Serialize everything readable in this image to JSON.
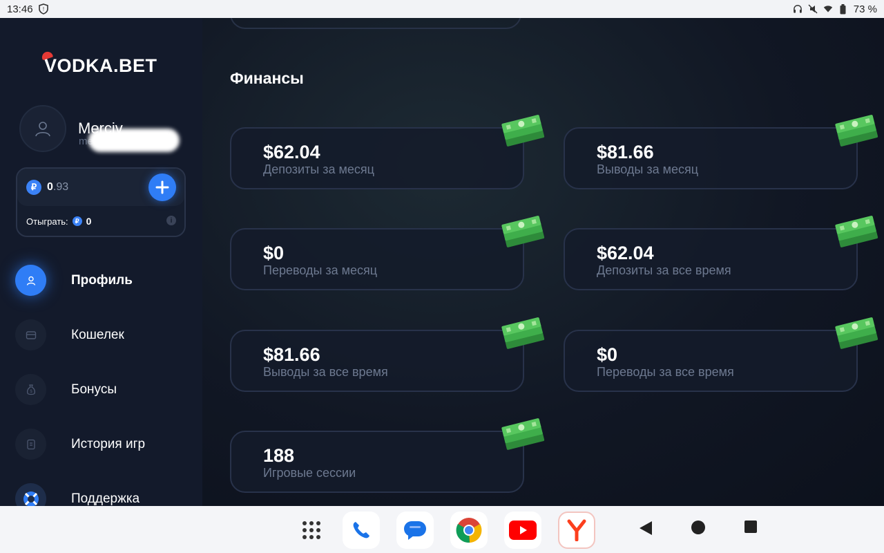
{
  "status_bar": {
    "time": "13:46",
    "battery_percent": "73 %"
  },
  "brand": {
    "logo_text": "VODKA",
    "logo_suffix": ".BET"
  },
  "profile": {
    "username": "Merciv",
    "username_sub": "me"
  },
  "wallet": {
    "currency_symbol": "₽",
    "balance_int": "0",
    "balance_frac": ".93",
    "wager_label": "Отыграть:",
    "wager_value": "0"
  },
  "nav": {
    "items": [
      {
        "label": "Профиль",
        "icon": "user-icon",
        "active": true
      },
      {
        "label": "Кошелек",
        "icon": "wallet-icon",
        "active": false
      },
      {
        "label": "Бонусы",
        "icon": "money-bag-icon",
        "active": false
      },
      {
        "label": "История игр",
        "icon": "history-icon",
        "active": false
      },
      {
        "label": "Поддержка",
        "icon": "lifebuoy-icon",
        "active": false
      }
    ]
  },
  "finance": {
    "title": "Финансы",
    "cards": [
      {
        "value": "$62.04",
        "label": "Депозиты за месяц"
      },
      {
        "value": "$81.66",
        "label": "Выводы за месяц"
      },
      {
        "value": "$0",
        "label": "Переводы за месяц"
      },
      {
        "value": "$62.04",
        "label": "Депозиты за все время"
      },
      {
        "value": "$81.66",
        "label": "Выводы за все время"
      },
      {
        "value": "$0",
        "label": "Переводы за все время"
      },
      {
        "value": "188",
        "label": "Игровые сессии"
      }
    ]
  },
  "dock": {
    "apps": [
      "apps-grid-icon",
      "phone-icon",
      "messages-icon",
      "chrome-icon",
      "youtube-icon",
      "yandex-icon"
    ]
  },
  "colors": {
    "accent": "#2f7df6",
    "sidebar_bg": "#131a2b",
    "main_bg": "#0d1220",
    "card_border": "#28324a",
    "muted_text": "#6d7990"
  }
}
